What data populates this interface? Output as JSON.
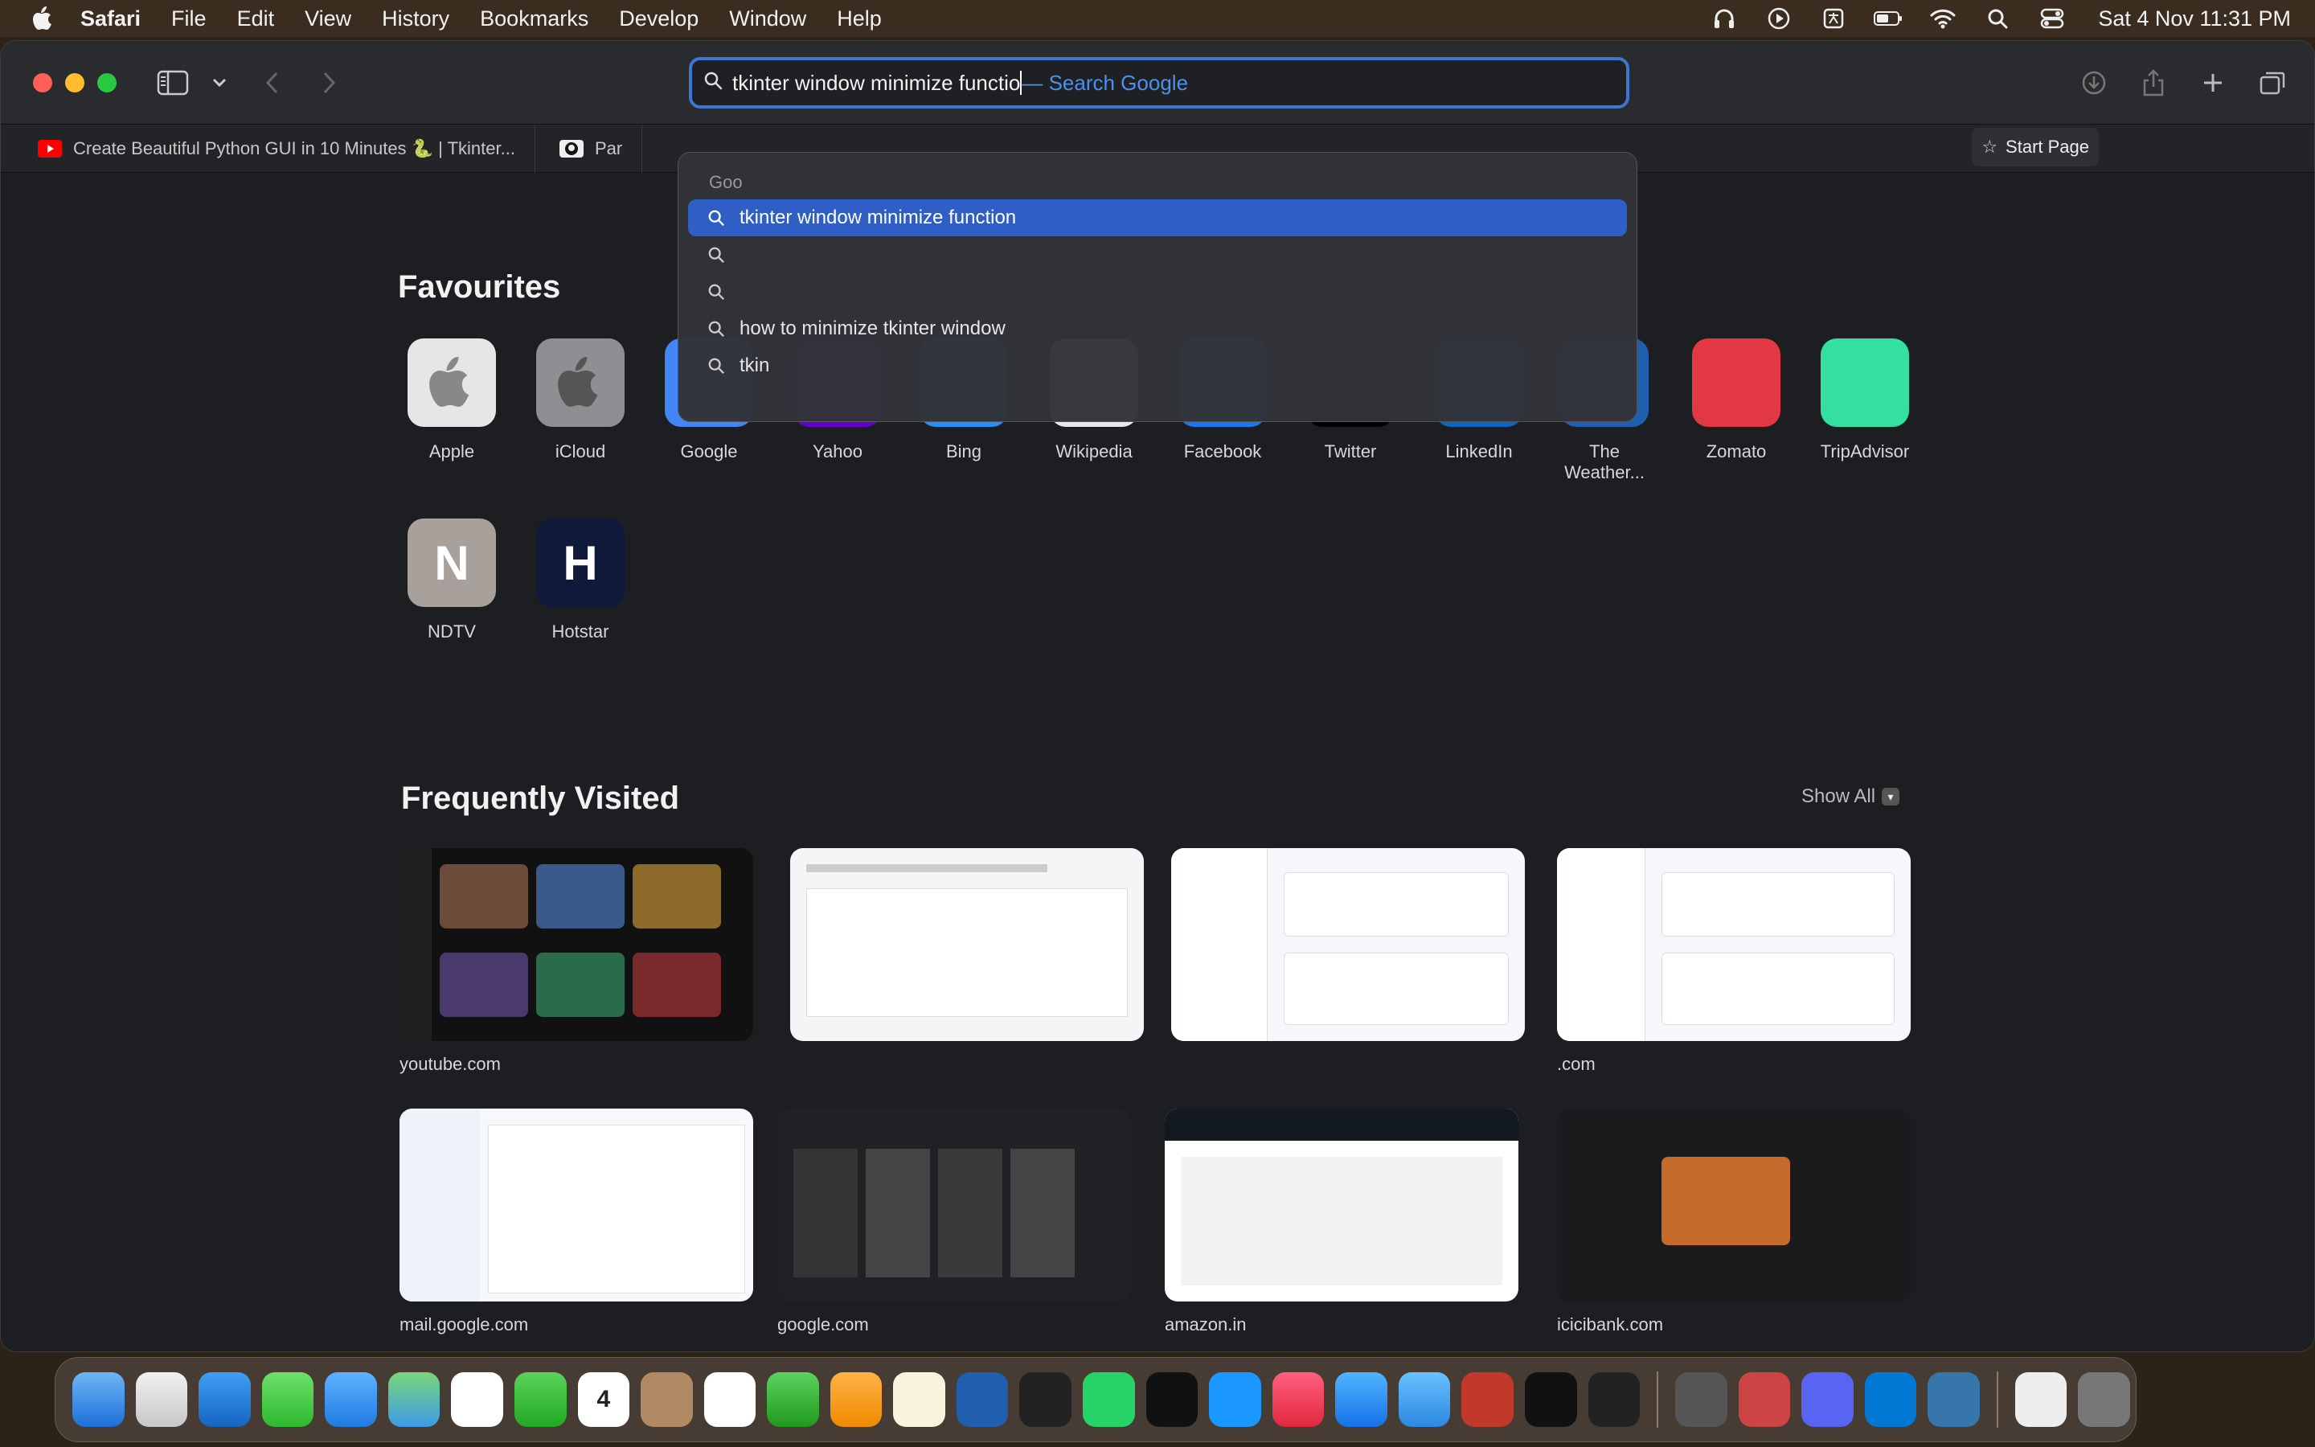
{
  "menubar": {
    "items": [
      "Safari",
      "File",
      "Edit",
      "View",
      "History",
      "Bookmarks",
      "Develop",
      "Window",
      "Help"
    ],
    "clock": "Sat 4 Nov  11:31 PM"
  },
  "toolbar": {
    "address_typed": "tkinter window minimize functio",
    "address_hint": "— Search Google"
  },
  "tabs": [
    {
      "label": "Create Beautiful Python GUI in 10 Minutes 🐍 | Tkinter...",
      "favicon": "youtube-icon"
    },
    {
      "label": "Par",
      "favicon": "github-icon"
    }
  ],
  "start_page_label": "Start Page",
  "suggestions": {
    "header": "Goo",
    "items": [
      "tkinter window minimize function",
      "",
      "",
      "how to minimize tkinter window",
      "tkin"
    ]
  },
  "favourites": {
    "title": "Favourites",
    "items": [
      {
        "label": "Apple",
        "color": "#e6e6e6",
        "glyph": ""
      },
      {
        "label": "iCloud",
        "color": "#8e8e93",
        "glyph": ""
      },
      {
        "label": "Google",
        "color": "#4285f4",
        "glyph": ""
      },
      {
        "label": "Yahoo",
        "color": "#6001d2",
        "glyph": ""
      },
      {
        "label": "Bing",
        "color": "#258ffa",
        "glyph": ""
      },
      {
        "label": "Wikipedia",
        "color": "#e8e8e8",
        "glyph": ""
      },
      {
        "label": "Facebook",
        "color": "#1877f2",
        "glyph": ""
      },
      {
        "label": "Twitter",
        "color": "#000000",
        "glyph": ""
      },
      {
        "label": "LinkedIn",
        "color": "#0a66c2",
        "glyph": ""
      },
      {
        "label": "The Weather...",
        "color": "#1f5fad",
        "glyph": ""
      },
      {
        "label": "Zomato",
        "color": "#e23744",
        "glyph": ""
      },
      {
        "label": "TripAdvisor",
        "color": "#34e0a1",
        "glyph": ""
      },
      {
        "label": "NDTV",
        "color": "#a8a09a",
        "glyph": "N"
      },
      {
        "label": "Hotstar",
        "color": "#0f1a3a",
        "glyph": "H"
      }
    ]
  },
  "frequently_visited": {
    "title": "Frequently Visited",
    "show_all": "Show All",
    "items": [
      {
        "label": "youtube.com"
      },
      {
        "label": ""
      },
      {
        "label": ""
      },
      {
        "label": ".com"
      },
      {
        "label": "mail.google.com"
      },
      {
        "label": "google.com"
      },
      {
        "label": "amazon.in"
      },
      {
        "label": "icicibank.com"
      }
    ]
  }
}
